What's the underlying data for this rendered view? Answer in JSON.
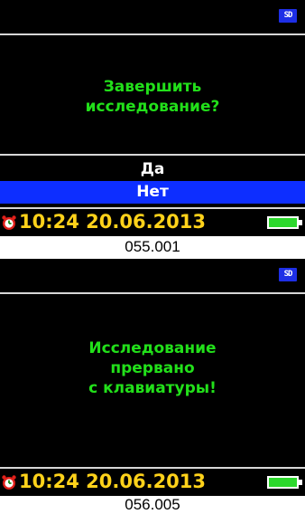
{
  "panel1": {
    "sd_icon": "SD",
    "message_lines": [
      "Завершить",
      "исследование?"
    ],
    "options": [
      {
        "label": "Да",
        "selected": false
      },
      {
        "label": "Нет",
        "selected": true
      }
    ],
    "status": {
      "alarm_icon": "alarm-clock-icon",
      "time": "10:24",
      "date": "20.06.2013",
      "battery_icon": "battery-icon"
    },
    "caption": "055.001"
  },
  "panel2": {
    "sd_icon": "SD",
    "message_lines": [
      "Исследование",
      "прервано",
      "с клавиатуры!"
    ],
    "status": {
      "alarm_icon": "alarm-clock-icon",
      "time": "10:24",
      "date": "20.06.2013",
      "battery_icon": "battery-icon"
    },
    "caption": "056.005"
  },
  "colors": {
    "screen_bg": "#000000",
    "message_text": "#22e01a",
    "highlight": "#0d2eff",
    "clock_text": "#ffd21a",
    "battery_fill": "#2bd82b",
    "alarm_red": "#e0201a",
    "sd_badge": "#1e2fe6",
    "divider": "#d7d7d7"
  }
}
